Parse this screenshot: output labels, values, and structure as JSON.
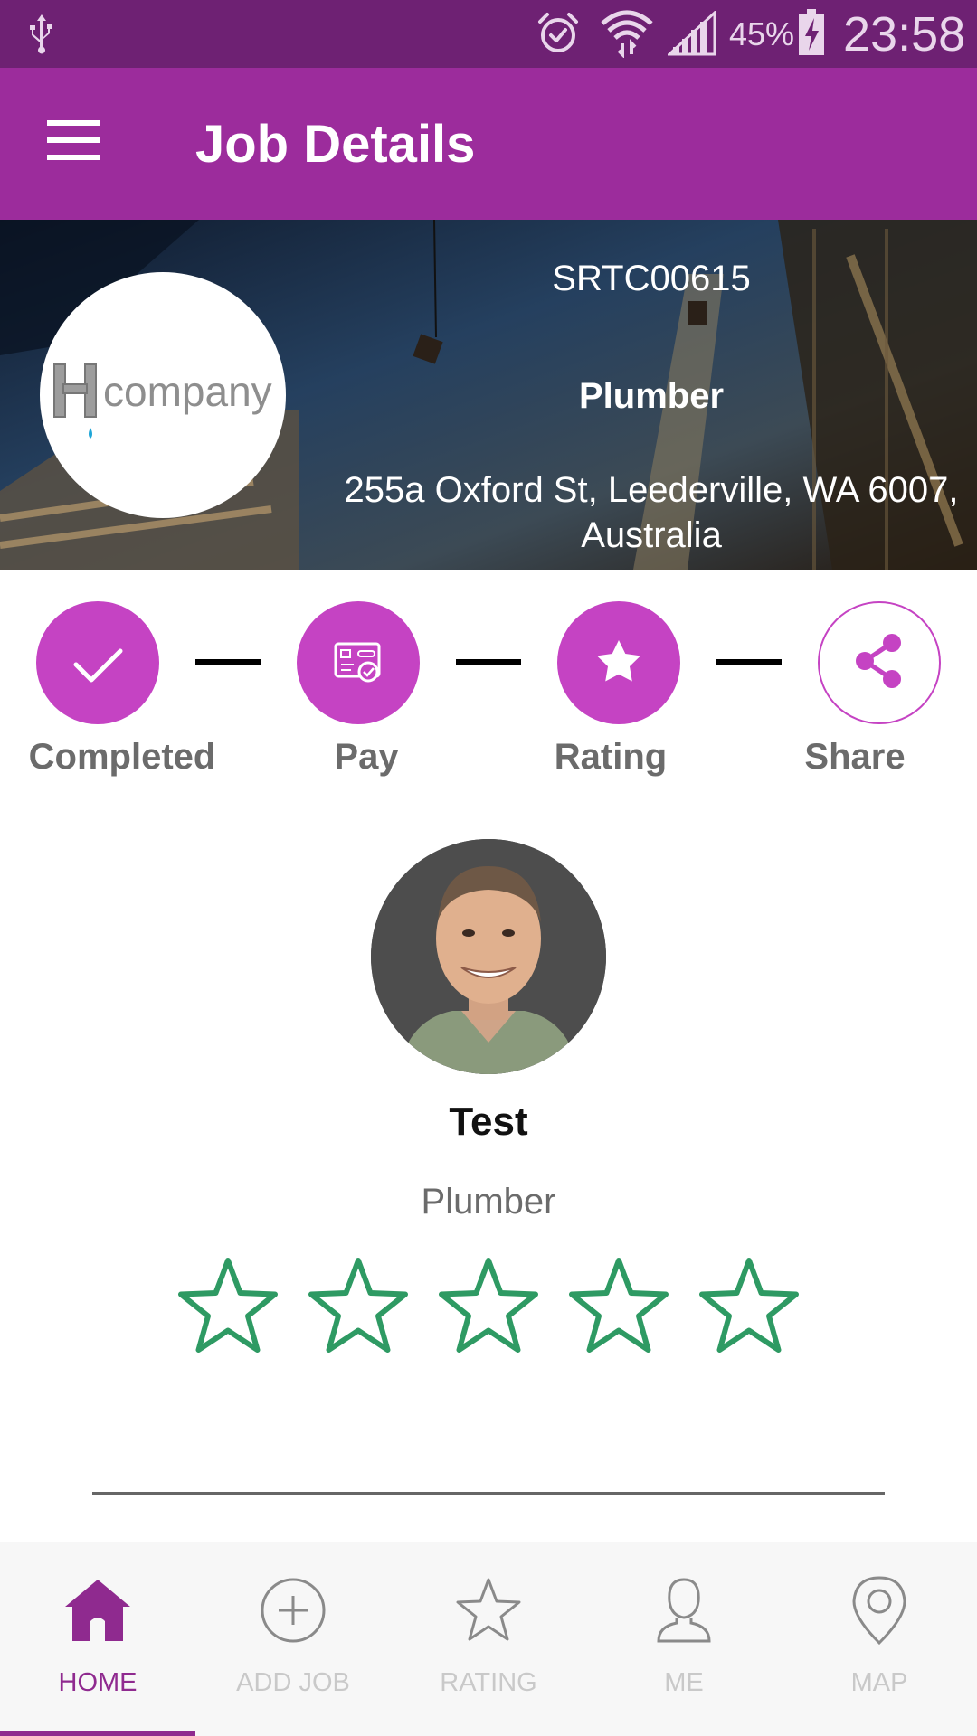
{
  "status_bar": {
    "battery_percent": "45%",
    "time": "23:58",
    "icons": [
      "usb-icon",
      "alarm-icon",
      "wifi-icon",
      "signal-icon",
      "battery-charging-icon"
    ]
  },
  "app_bar": {
    "title": "Job Details",
    "menu_icon": "hamburger-menu-icon"
  },
  "job": {
    "id": "SRTC00615",
    "trade": "Plumber",
    "address": "255a Oxford St, Leederville, WA 6007, Australia",
    "company_logo_text": "company"
  },
  "steps": [
    {
      "label": "Completed",
      "icon": "check-icon",
      "state": "filled"
    },
    {
      "label": "Pay",
      "icon": "card-payment-icon",
      "state": "filled"
    },
    {
      "label": "Rating",
      "icon": "star-icon",
      "state": "filled"
    },
    {
      "label": "Share",
      "icon": "share-icon",
      "state": "outline"
    }
  ],
  "worker": {
    "name": "Test",
    "trade": "Plumber",
    "rating": 0,
    "rating_max": 5
  },
  "bottom_nav": {
    "active": "HOME",
    "items": [
      {
        "label": "HOME",
        "icon": "home-icon"
      },
      {
        "label": "ADD JOB",
        "icon": "add-circle-icon"
      },
      {
        "label": "RATING",
        "icon": "star-outline-icon"
      },
      {
        "label": "ME",
        "icon": "person-icon"
      },
      {
        "label": "MAP",
        "icon": "map-pin-icon"
      }
    ]
  },
  "colors": {
    "status_bar": "#6e2173",
    "app_bar": "#9c2c9c",
    "accent": "#c543c3",
    "star": "#2e9a63",
    "nav_active": "#8f2a8f",
    "nav_inactive": "#c9c9c9"
  }
}
